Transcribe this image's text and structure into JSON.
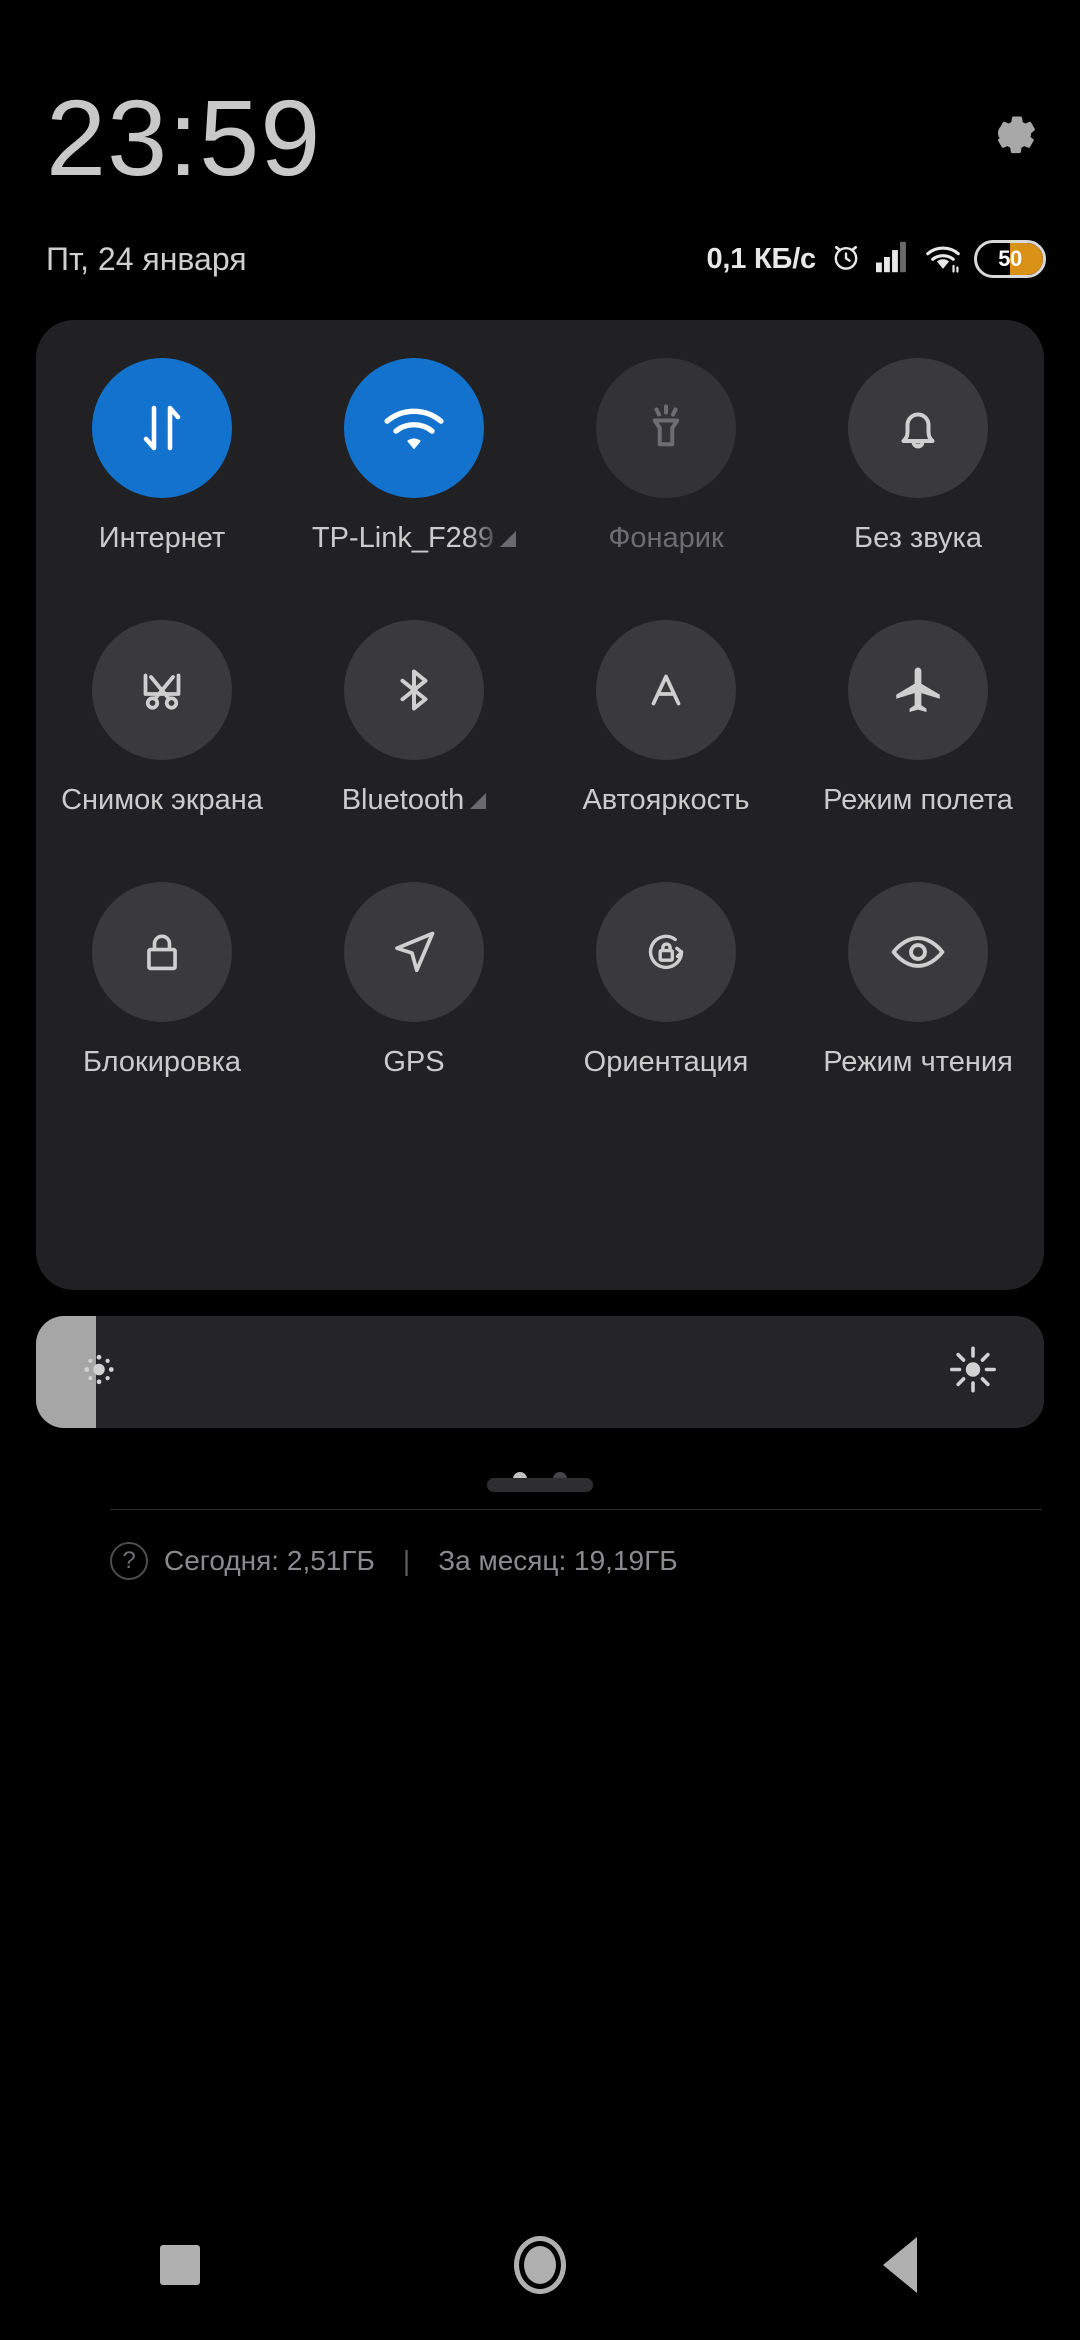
{
  "statusbar": {
    "clock": "23:59",
    "date": "Пт, 24 января",
    "net_speed": "0,1 КБ/с",
    "alarm_icon": "alarm-clock-icon",
    "signal_icon": "cellular-signal-icon",
    "wifi_icon": "wifi-icon",
    "battery_level": "50",
    "battery_percent": 50,
    "battery_color": "#d99116",
    "settings_icon": "gear-icon"
  },
  "quick_settings": {
    "accent_color": "#1272cd",
    "tiles": [
      {
        "label": "Интернет",
        "icon": "data-transfer-icon",
        "state": "active",
        "expandable": false
      },
      {
        "label": "TP-Link_F289",
        "icon": "wifi-icon",
        "state": "active",
        "expandable": true,
        "truncated": true
      },
      {
        "label": "Фонарик",
        "icon": "flashlight-icon",
        "state": "disabled",
        "expandable": false
      },
      {
        "label": "Без звука",
        "icon": "bell-icon",
        "state": "inactive",
        "expandable": false
      },
      {
        "label": "Снимок экрана",
        "icon": "screenshot-icon",
        "state": "inactive",
        "expandable": false
      },
      {
        "label": "Bluetooth",
        "icon": "bluetooth-icon",
        "state": "inactive",
        "expandable": true
      },
      {
        "label": "Автояркость",
        "icon": "auto-brightness-icon",
        "state": "inactive",
        "expandable": false
      },
      {
        "label": "Режим полета",
        "icon": "airplane-icon",
        "state": "inactive",
        "expandable": false
      },
      {
        "label": "Блокировка",
        "icon": "lock-icon",
        "state": "inactive",
        "expandable": false
      },
      {
        "label": "GPS",
        "icon": "navigation-arrow-icon",
        "state": "inactive",
        "expandable": false
      },
      {
        "label": "Ориентация",
        "icon": "rotation-lock-icon",
        "state": "inactive",
        "expandable": false
      },
      {
        "label": "Режим чтения",
        "icon": "eye-icon",
        "state": "inactive",
        "expandable": false
      }
    ],
    "pages": {
      "count": 2,
      "current": 1
    },
    "data_usage": {
      "help_icon": "question-mark-icon",
      "today": "Сегодня: 2,51ГБ",
      "separator": "|",
      "month": "За месяц: 19,19ГБ"
    }
  },
  "brightness": {
    "value_percent": 6,
    "low_icon": "brightness-low-icon",
    "high_icon": "brightness-high-icon"
  },
  "navbar": {
    "recents": "recents-square-icon",
    "home": "home-circle-icon",
    "back": "back-triangle-icon"
  }
}
